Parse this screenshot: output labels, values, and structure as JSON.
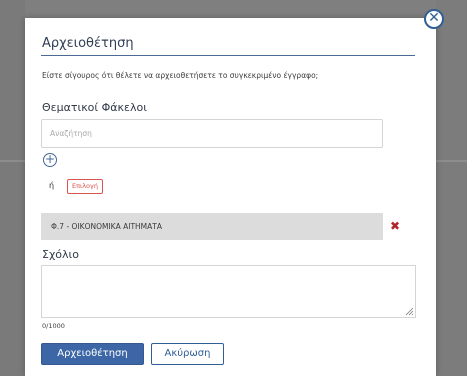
{
  "dialog": {
    "title": "Αρχειοθέτηση",
    "question": "Είστε σίγουρος ότι θέλετε να αρχειοθετήσετε το συγκεκριμένο έγγραφο;",
    "folders_label": "Θεματικοί Φάκελοι",
    "search_placeholder": "Αναζήτηση",
    "or_text": "ή",
    "select_label": "Επιλογή",
    "selected_folder": "Φ.7 - ΟΙΚΟΝΟΜΙΚΑ ΑΙΤΗΜΑΤΑ",
    "comment_label": "Σχόλιο",
    "comment_value": "",
    "char_counter": "0/1000",
    "confirm_label": "Αρχειοθέτηση",
    "cancel_label": "Ακύρωση"
  },
  "icons": {
    "close": "close-icon",
    "add": "plus-circle-icon",
    "remove": "remove-x-icon",
    "resize": "resize-grip-icon"
  },
  "colors": {
    "accent": "#3c66a5",
    "danger": "#d9534f",
    "remove": "#b0262a"
  }
}
